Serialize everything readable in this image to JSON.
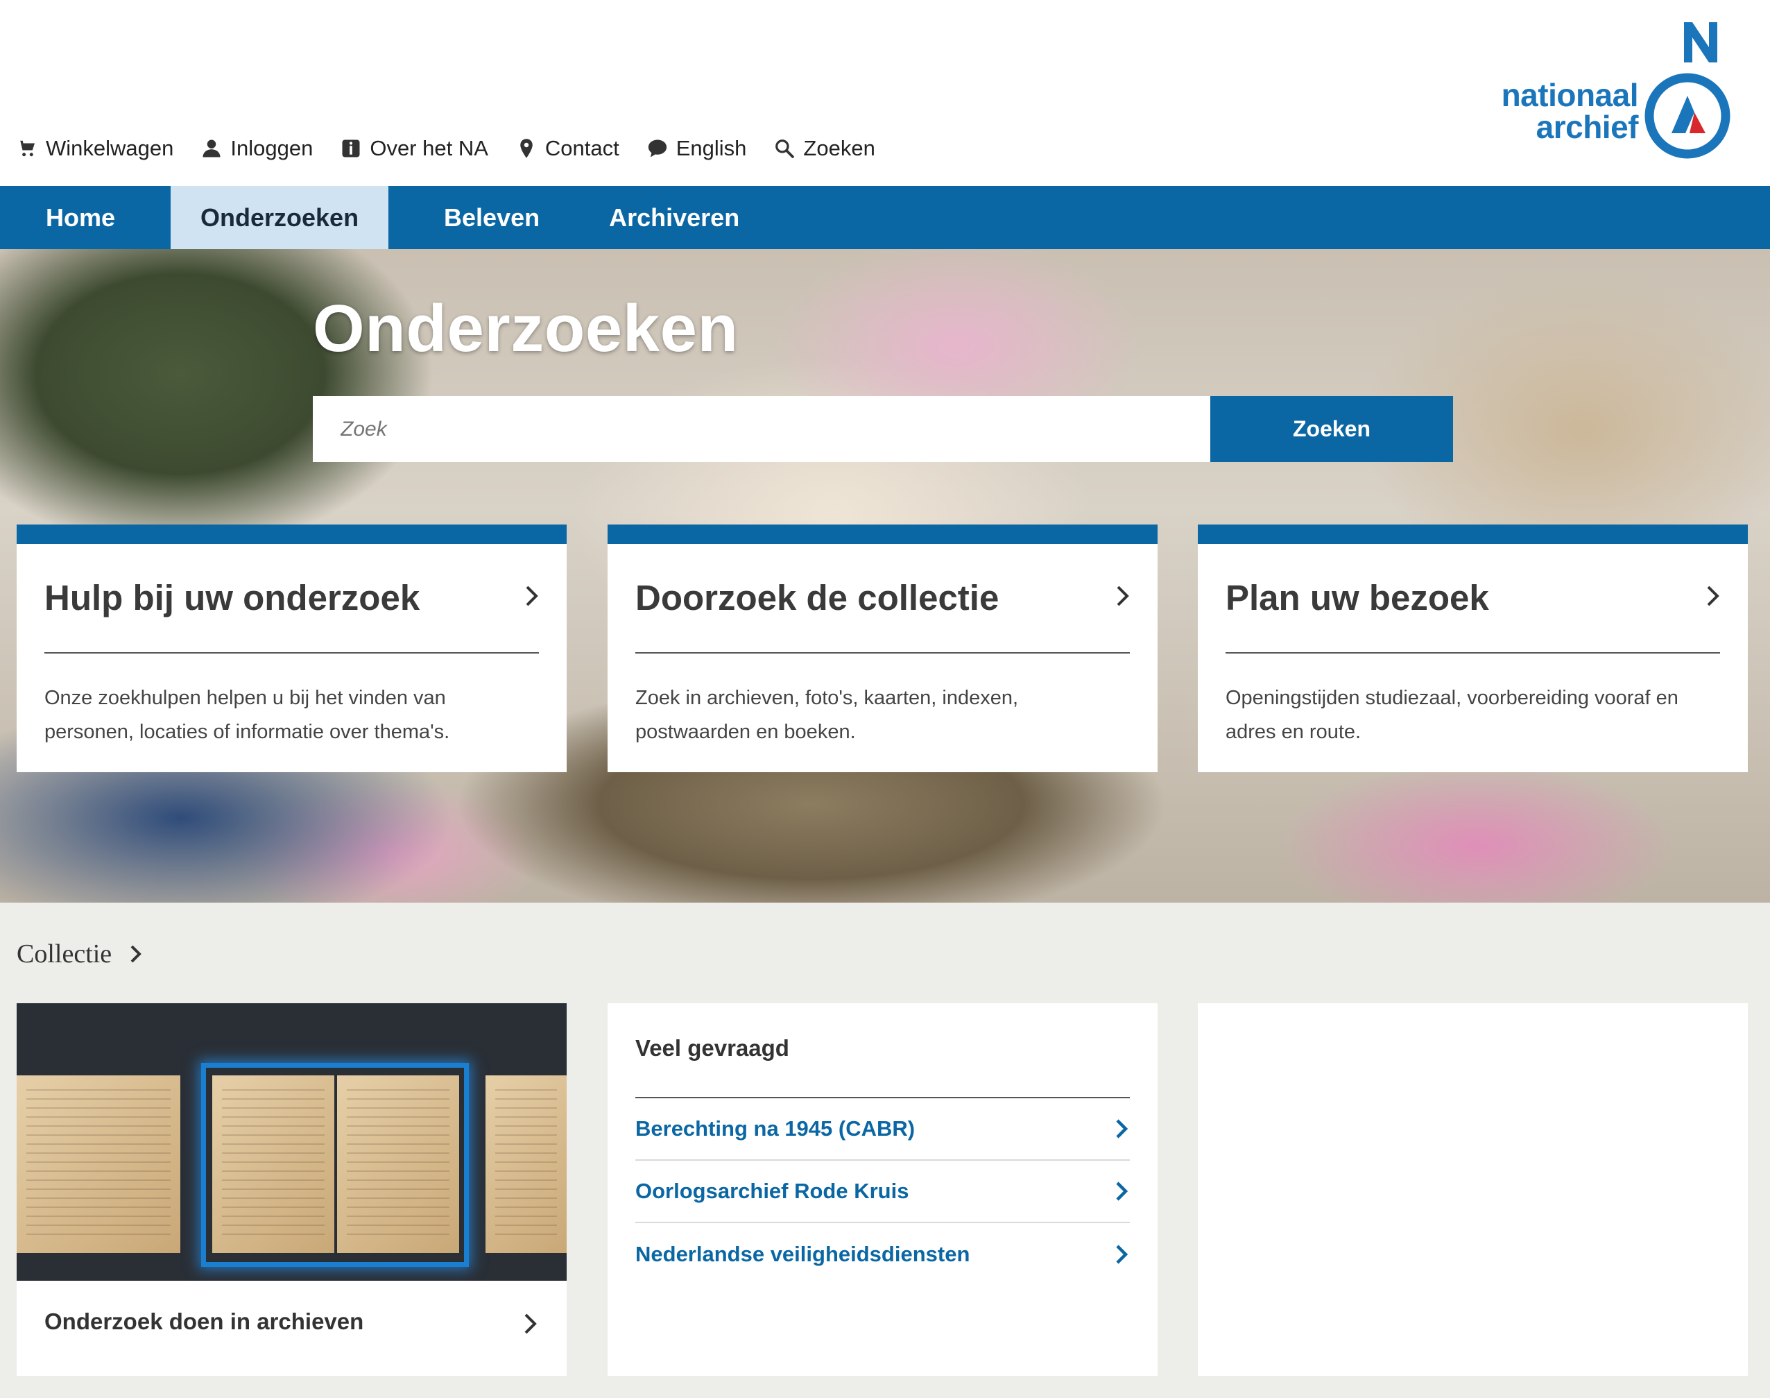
{
  "utility_links": [
    {
      "label": "Winkelwagen",
      "icon": "cart-icon"
    },
    {
      "label": "Inloggen",
      "icon": "user-icon"
    },
    {
      "label": "Over het NA",
      "icon": "info-icon"
    },
    {
      "label": "Contact",
      "icon": "location-pin-icon"
    },
    {
      "label": "English",
      "icon": "speech-bubble-icon"
    },
    {
      "label": "Zoeken",
      "icon": "search-icon"
    }
  ],
  "logo": {
    "line1": "nationaal",
    "line2": "archief",
    "letter": "N"
  },
  "nav": [
    {
      "label": "Home"
    },
    {
      "label": "Onderzoeken",
      "active": true
    },
    {
      "label": "Beleven"
    },
    {
      "label": "Archiveren"
    }
  ],
  "hero": {
    "title": "Onderzoeken",
    "search_placeholder": "Zoek",
    "search_button": "Zoeken"
  },
  "cards": [
    {
      "title": "Hulp bij uw onderzoek",
      "description": "Onze zoekhulpen helpen u bij het vinden van personen, locaties of informatie over thema's."
    },
    {
      "title": "Doorzoek de collectie",
      "description": "Zoek in archieven, foto's, kaarten, indexen, postwaarden en boeken."
    },
    {
      "title": "Plan uw bezoek",
      "description": "Openingstijden studiezaal, voorbereiding vooraf en adres en route."
    }
  ],
  "collectie": {
    "title": "Collectie",
    "image_panel_caption": "Onderzoek doen in archieven",
    "list_heading": "Veel gevraagd",
    "list_items": [
      "Berechting na 1945 (CABR)",
      "Oorlogsarchief Rode Kruis",
      "Nederlandse veiligheidsdiensten"
    ]
  },
  "colors": {
    "brand_blue": "#0a67a4",
    "logo_blue": "#1a75bb",
    "logo_red": "#d9272e",
    "active_nav": "#cfe3f2",
    "section_bg": "#ededea"
  }
}
